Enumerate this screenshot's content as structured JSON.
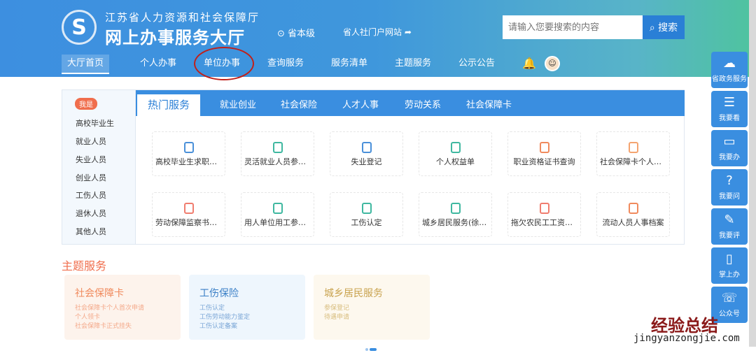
{
  "header": {
    "logo_text": "S",
    "org": "江苏省人力资源和社会保障厅",
    "hall": "网上办事服务大厅",
    "location": "省本级",
    "portal": "省人社门户网站",
    "search_placeholder": "请输入您要搜索的内容",
    "search_button": "搜索"
  },
  "nav": [
    "大厅首页",
    "个人办事",
    "单位办事",
    "查询服务",
    "服务清单",
    "主题服务",
    "公示公告"
  ],
  "sidebar": {
    "badge": "我是",
    "items": [
      "高校毕业生",
      "就业人员",
      "失业人员",
      "创业人员",
      "工伤人员",
      "退休人员",
      "其他人员"
    ]
  },
  "tabs": [
    "热门服务",
    "就业创业",
    "社会保险",
    "人才人事",
    "劳动关系",
    "社会保障卡"
  ],
  "services": [
    {
      "label": "高校毕业生求职登记",
      "color": "#4a90d9"
    },
    {
      "label": "灵活就业人员参保登记",
      "color": "#3fb8a0"
    },
    {
      "label": "失业登记",
      "color": "#4a90d9"
    },
    {
      "label": "个人权益单",
      "color": "#3fb8a0"
    },
    {
      "label": "职业资格证书查询",
      "color": "#f08a5d"
    },
    {
      "label": "社会保障卡个人首次申领",
      "color": "#f4a470"
    },
    {
      "label": "劳动保障监察书面投诉",
      "color": "#f07d6f"
    },
    {
      "label": "用人单位用工参保登记",
      "color": "#3fb8a0"
    },
    {
      "label": "工伤认定",
      "color": "#3fb8a0"
    },
    {
      "label": "城乡居民服务(徐州)",
      "color": "#3fb8a0"
    },
    {
      "label": "拖欠农民工工资线索",
      "color": "#f07d6f"
    },
    {
      "label": "流动人员人事档案",
      "color": "#f08a5d"
    }
  ],
  "theme": {
    "heading": "主题服务",
    "cards": [
      {
        "title": "社会保障卡",
        "links": [
          "社会保障卡个人首次申请",
          "个人领卡",
          "社会保障卡正式挂失"
        ]
      },
      {
        "title": "工伤保险",
        "links": [
          "工伤认定",
          "工伤劳动能力鉴定",
          "工伤认定备案"
        ]
      },
      {
        "title": "城乡居民服务",
        "links": [
          "参保登记",
          "待遇申请"
        ]
      }
    ]
  },
  "float": [
    "省政务服务",
    "我要看",
    "我要办",
    "我要问",
    "我要评",
    "掌上办",
    "公众号"
  ],
  "watermark": {
    "cn": "经验总结",
    "url": "jingyanzongjie.com"
  }
}
